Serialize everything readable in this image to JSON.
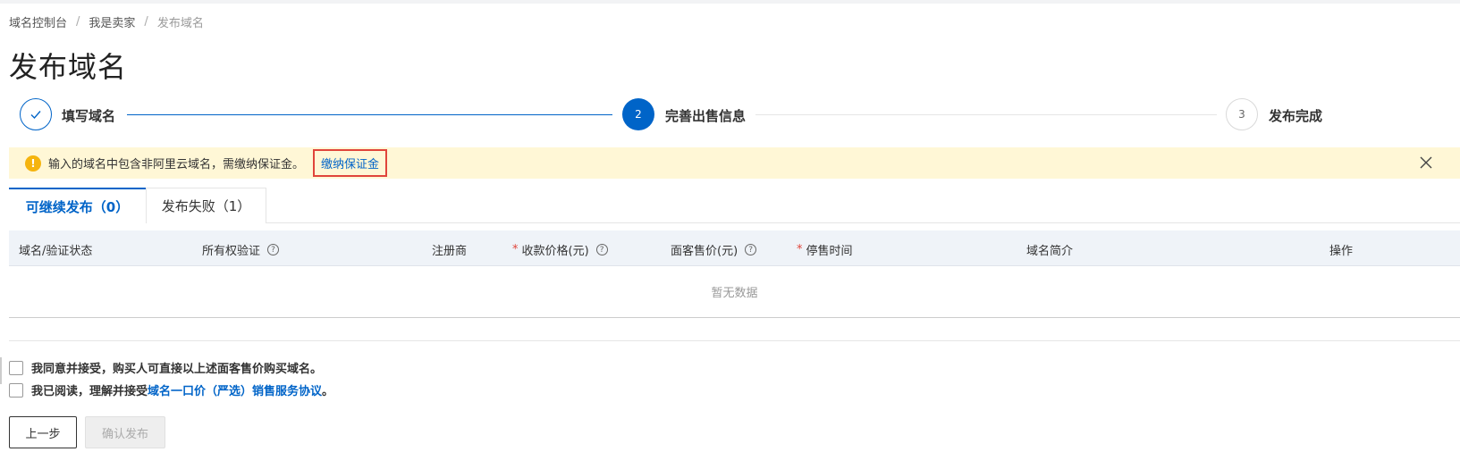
{
  "breadcrumb": {
    "items": [
      "域名控制台",
      "我是卖家"
    ],
    "current": "发布域名",
    "separator": "/"
  },
  "page_title": "发布域名",
  "steps": [
    {
      "index": "",
      "label": "填写域名",
      "status": "done"
    },
    {
      "index": "2",
      "label": "完善出售信息",
      "status": "active"
    },
    {
      "index": "3",
      "label": "发布完成",
      "status": "wait"
    }
  ],
  "alert": {
    "icon": "!",
    "text": "输入的域名中包含非阿里云域名，需缴纳保证金。",
    "link_label": "缴纳保证金"
  },
  "tabs": [
    {
      "label": "可继续发布（0）",
      "active": true
    },
    {
      "label": "发布失败（1）",
      "active": false
    }
  ],
  "table": {
    "columns": [
      {
        "label": "域名/验证状态",
        "required": false,
        "help": false
      },
      {
        "label": "所有权验证",
        "required": false,
        "help": true
      },
      {
        "label": "注册商",
        "required": false,
        "help": false
      },
      {
        "label": "收款价格(元)",
        "required": true,
        "help": true
      },
      {
        "label": "面客售价(元)",
        "required": false,
        "help": true
      },
      {
        "label": "停售时间",
        "required": true,
        "help": false
      },
      {
        "label": "域名简介",
        "required": false,
        "help": false
      },
      {
        "label": "操作",
        "required": false,
        "help": false
      }
    ],
    "required_mark": "*",
    "help_mark": "?",
    "empty_text": "暂无数据"
  },
  "agreements": [
    {
      "text": "我同意并接受，购买人可直接以上述面客售价购买域名。"
    },
    {
      "prefix": "我已阅读，理解并接受",
      "link": "域名一口价（严选）销售服务协议",
      "suffix": "。"
    }
  ],
  "buttons": {
    "prev": "上一步",
    "confirm": "确认发布"
  },
  "colors": {
    "primary": "#0064c8",
    "alert_bg": "#fff7d6",
    "warning": "#f5b40e",
    "highlight_border": "#e0453b"
  }
}
